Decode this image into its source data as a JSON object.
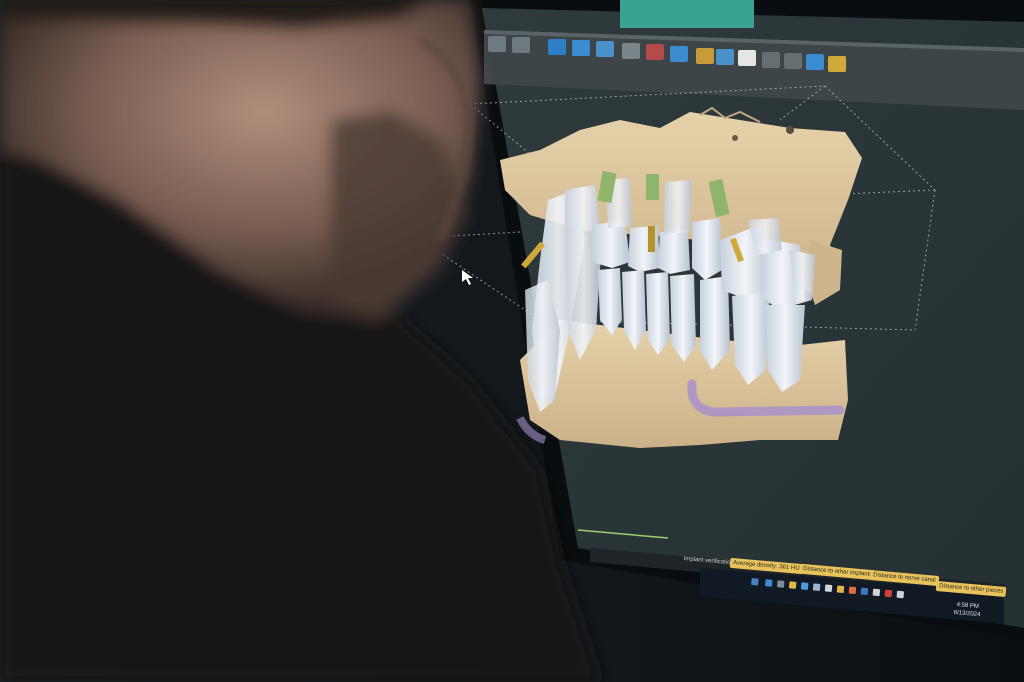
{
  "toolbar": {
    "icons": [
      "tooth-view-icon",
      "bone-view-icon",
      "move-tool-icon",
      "rotate-tool-icon",
      "arch-icon",
      "implant-tool-icon",
      "pin-icon",
      "select-icon",
      "curve-icon",
      "brush-icon",
      "tooth-icon",
      "undo-icon",
      "redo-icon",
      "bottle-icon",
      "ruler-icon"
    ]
  },
  "viewport": {
    "subject": "3D dental model with jaw bone, teeth and implants"
  },
  "status_bar": {
    "verification_label": "Implant verification",
    "chips": [
      "Average density: 361 HU",
      "Distance to other implants",
      "Distance to nerve canal",
      "Distance to other pieces"
    ]
  },
  "taskbar": {
    "time": "4:58 PM",
    "date": "6/13/2024"
  },
  "colors": {
    "bone": "#d9c39a",
    "tooth": "#dfe5ee",
    "implant_thread": "#8fb56a",
    "nerve_canal": "#a892c9",
    "viewport_bg": "#2b3437"
  }
}
